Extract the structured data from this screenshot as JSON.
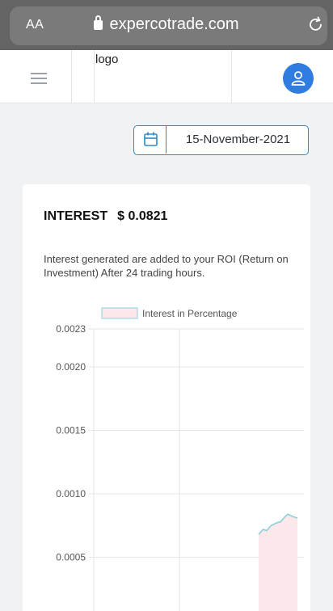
{
  "browser": {
    "text_size_label": "AA",
    "url": "expercotrade.com"
  },
  "header": {
    "logo_text": "logo"
  },
  "date_picker": {
    "value": "15-November-2021"
  },
  "interest_card": {
    "title": "INTEREST",
    "amount": "$ 0.0821",
    "description": "Interest generated are added to your ROI (Return on Investment) After 24 trading hours."
  },
  "colors": {
    "accent": "#2c8ac9",
    "avatar": "#2f7de0",
    "series_line": "#8ad0d8",
    "series_fill": "#fce8ea"
  },
  "chart_data": {
    "type": "area",
    "series": [
      {
        "name": "Interest in Percentage",
        "points": [
          [
            0.0,
            0.00068
          ],
          [
            0.06,
            0.00072
          ],
          [
            0.11,
            0.00071
          ],
          [
            0.17,
            0.00075
          ],
          [
            0.24,
            0.00077
          ],
          [
            0.3,
            0.00078
          ],
          [
            0.36,
            0.00082
          ],
          [
            0.4,
            0.00084
          ],
          [
            0.47,
            0.00082
          ],
          [
            0.53,
            0.00081
          ]
        ]
      }
    ],
    "y_ticks": [
      "0.0023",
      "0.0020",
      "0.0015",
      "0.0010",
      "0.0005"
    ],
    "y_tick_values": [
      0.0023,
      0.002,
      0.0015,
      0.001,
      0.0005
    ],
    "ylim": [
      0.0,
      0.0023
    ],
    "legend_position": "top-center",
    "grid": true
  }
}
